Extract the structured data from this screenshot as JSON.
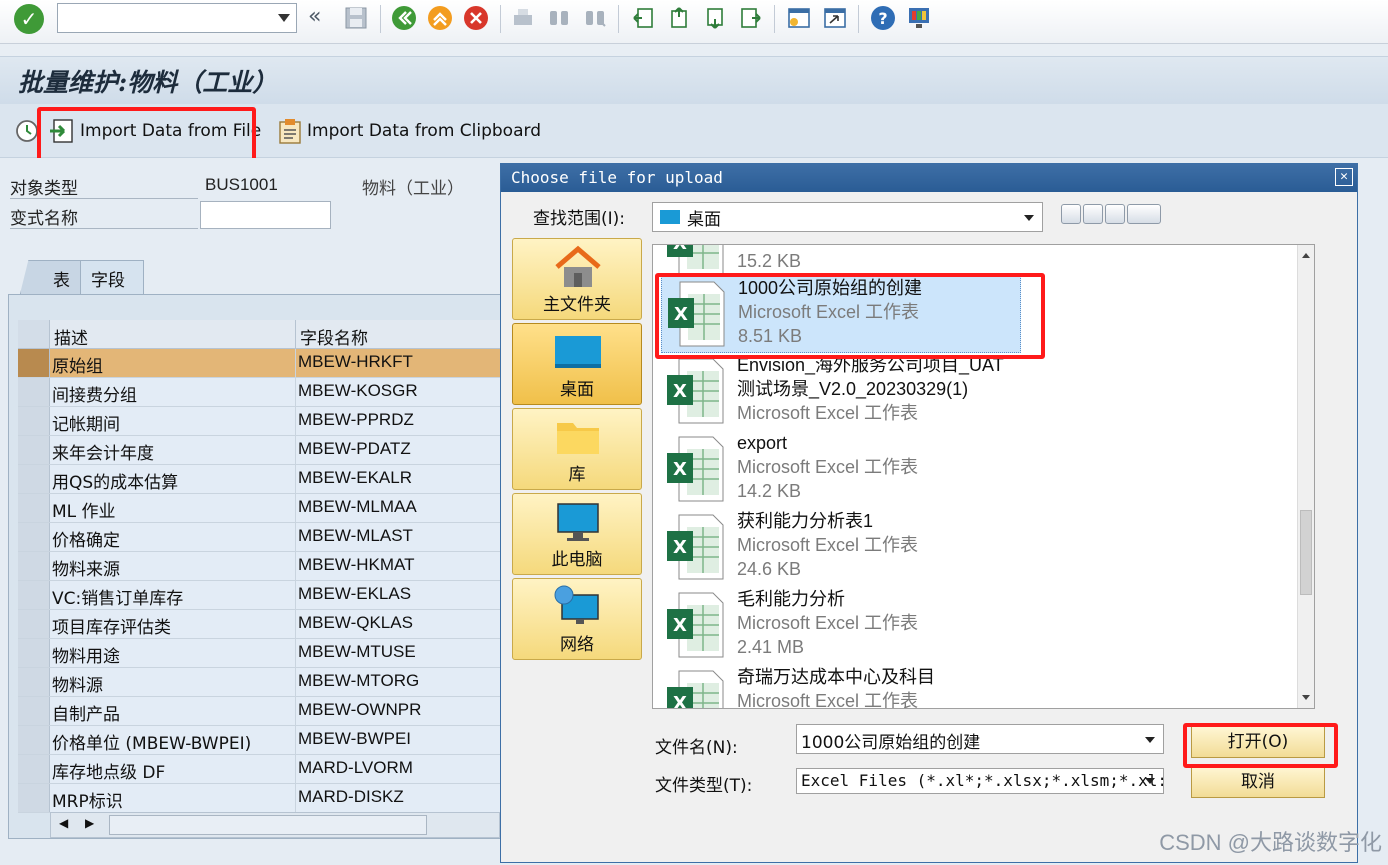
{
  "toolbar": {
    "command_field_value": "",
    "icons": [
      "enter-icon",
      "back-icon",
      "exit-icon",
      "cancel-icon",
      "save-icon",
      "print-icon",
      "find-icon",
      "find-next-icon",
      "first-page-icon",
      "prev-page-icon",
      "next-page-icon",
      "last-page-icon",
      "new-session-icon",
      "shortcut-icon",
      "help-icon",
      "layout-icon"
    ]
  },
  "title": "批量维护:物料（工业）",
  "app_toolbar": {
    "import_file": "Import Data from File",
    "import_clipboard": "Import Data from Clipboard"
  },
  "header": {
    "object_type_label": "对象类型",
    "object_type_value": "BUS1001",
    "object_type_desc": "物料（工业）",
    "variant_label": "变式名称",
    "variant_value": ""
  },
  "tabs": {
    "table": "表",
    "fields": "字段"
  },
  "grid": {
    "col_desc": "描述",
    "col_field": "字段名称",
    "rows": [
      {
        "desc": "原始组",
        "field": "MBEW-HRKFT",
        "selected": true
      },
      {
        "desc": "间接费分组",
        "field": "MBEW-KOSGR"
      },
      {
        "desc": "记帐期间",
        "field": "MBEW-PPRDZ"
      },
      {
        "desc": "来年会计年度",
        "field": "MBEW-PDATZ"
      },
      {
        "desc": "用QS的成本估算",
        "field": "MBEW-EKALR"
      },
      {
        "desc": "ML 作业",
        "field": "MBEW-MLMAA"
      },
      {
        "desc": "价格确定",
        "field": "MBEW-MLAST"
      },
      {
        "desc": "物料来源",
        "field": "MBEW-HKMAT"
      },
      {
        "desc": "VC:销售订单库存",
        "field": "MBEW-EKLAS"
      },
      {
        "desc": "项目库存评估类",
        "field": "MBEW-QKLAS"
      },
      {
        "desc": "物料用途",
        "field": "MBEW-MTUSE"
      },
      {
        "desc": "物料源",
        "field": "MBEW-MTORG"
      },
      {
        "desc": "自制产品",
        "field": "MBEW-OWNPR"
      },
      {
        "desc": "价格单位 (MBEW-BWPEI)",
        "field": "MBEW-BWPEI"
      },
      {
        "desc": "库存地点级 DF",
        "field": "MARD-LVORM"
      },
      {
        "desc": "MRP标识",
        "field": "MARD-DISKZ"
      }
    ]
  },
  "dialog": {
    "title": "Choose file for upload",
    "lookin_label": "查找范围(I):",
    "lookin_value": "桌面",
    "places": [
      "主文件夹",
      "桌面",
      "库",
      "此电脑",
      "网络"
    ],
    "files": [
      {
        "name": "",
        "type": "",
        "size": "15.2 KB"
      },
      {
        "name": "1000公司原始组的创建",
        "type": "Microsoft Excel 工作表",
        "size": "8.51 KB",
        "selected": true
      },
      {
        "name": "Envision_海外服务公司项目_UAT",
        "name2": "测试场景_V2.0_20230329(1)",
        "type": "Microsoft Excel 工作表"
      },
      {
        "name": "export",
        "type": "Microsoft Excel 工作表",
        "size": "14.2 KB"
      },
      {
        "name": "获利能力分析表1",
        "type": "Microsoft Excel 工作表",
        "size": "24.6 KB"
      },
      {
        "name": "毛利能力分析",
        "type": "Microsoft Excel 工作表",
        "size": "2.41 MB"
      },
      {
        "name": "奇瑞万达成本中心及科目",
        "type": "Microsoft Excel 工作表"
      }
    ],
    "filename_label": "文件名(N):",
    "filename_value": "1000公司原始组的创建",
    "filetype_label": "文件类型(T):",
    "filetype_value": "Excel Files (*.xl*;*.xlsx;*.xlsm;*.xl:",
    "open_button": "打开(O)",
    "cancel_button": "取消"
  },
  "watermark": "CSDN @大路谈数字化",
  "colors": {
    "highlight": "#ff1a1a",
    "selected_row": "#e3b677",
    "dialog_title": "#2a5c95"
  }
}
